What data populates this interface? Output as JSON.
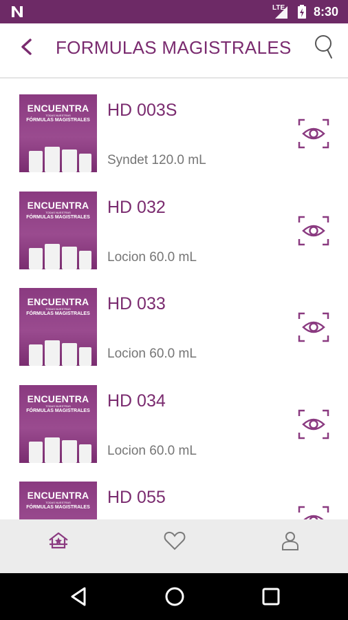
{
  "status_bar": {
    "network": "LTE",
    "time": "8:30",
    "icons": [
      "n-notification-icon",
      "signal-icon",
      "battery-icon"
    ]
  },
  "app_bar": {
    "title": "FORMULAS MAGISTRALES",
    "icons": [
      "back-arrow-icon",
      "search-icon"
    ]
  },
  "thumbnail": {
    "headline": "ENCUENTRA",
    "tagline": "TODAS NUESTRAS",
    "subline": "FÓRMULAS MAGISTRALES"
  },
  "products": [
    {
      "code": "HD 003S",
      "description": "Syndet 120.0 mL"
    },
    {
      "code": "HD 032",
      "description": "Locion 60.0 mL"
    },
    {
      "code": "HD 033",
      "description": "Locion 60.0 mL"
    },
    {
      "code": "HD 034",
      "description": "Locion 60.0 mL"
    },
    {
      "code": "HD 055",
      "description": ""
    }
  ],
  "bottom_nav": {
    "items": [
      "home-icon",
      "heart-icon",
      "profile-icon"
    ]
  },
  "system_nav": {
    "items": [
      "back-triangle-icon",
      "home-circle-icon",
      "recents-square-icon"
    ]
  },
  "colors": {
    "status_bar": "#6d2a66",
    "accent": "#7a2b6f",
    "subtitle": "#757575",
    "bottom_nav_bg": "#ececec"
  }
}
